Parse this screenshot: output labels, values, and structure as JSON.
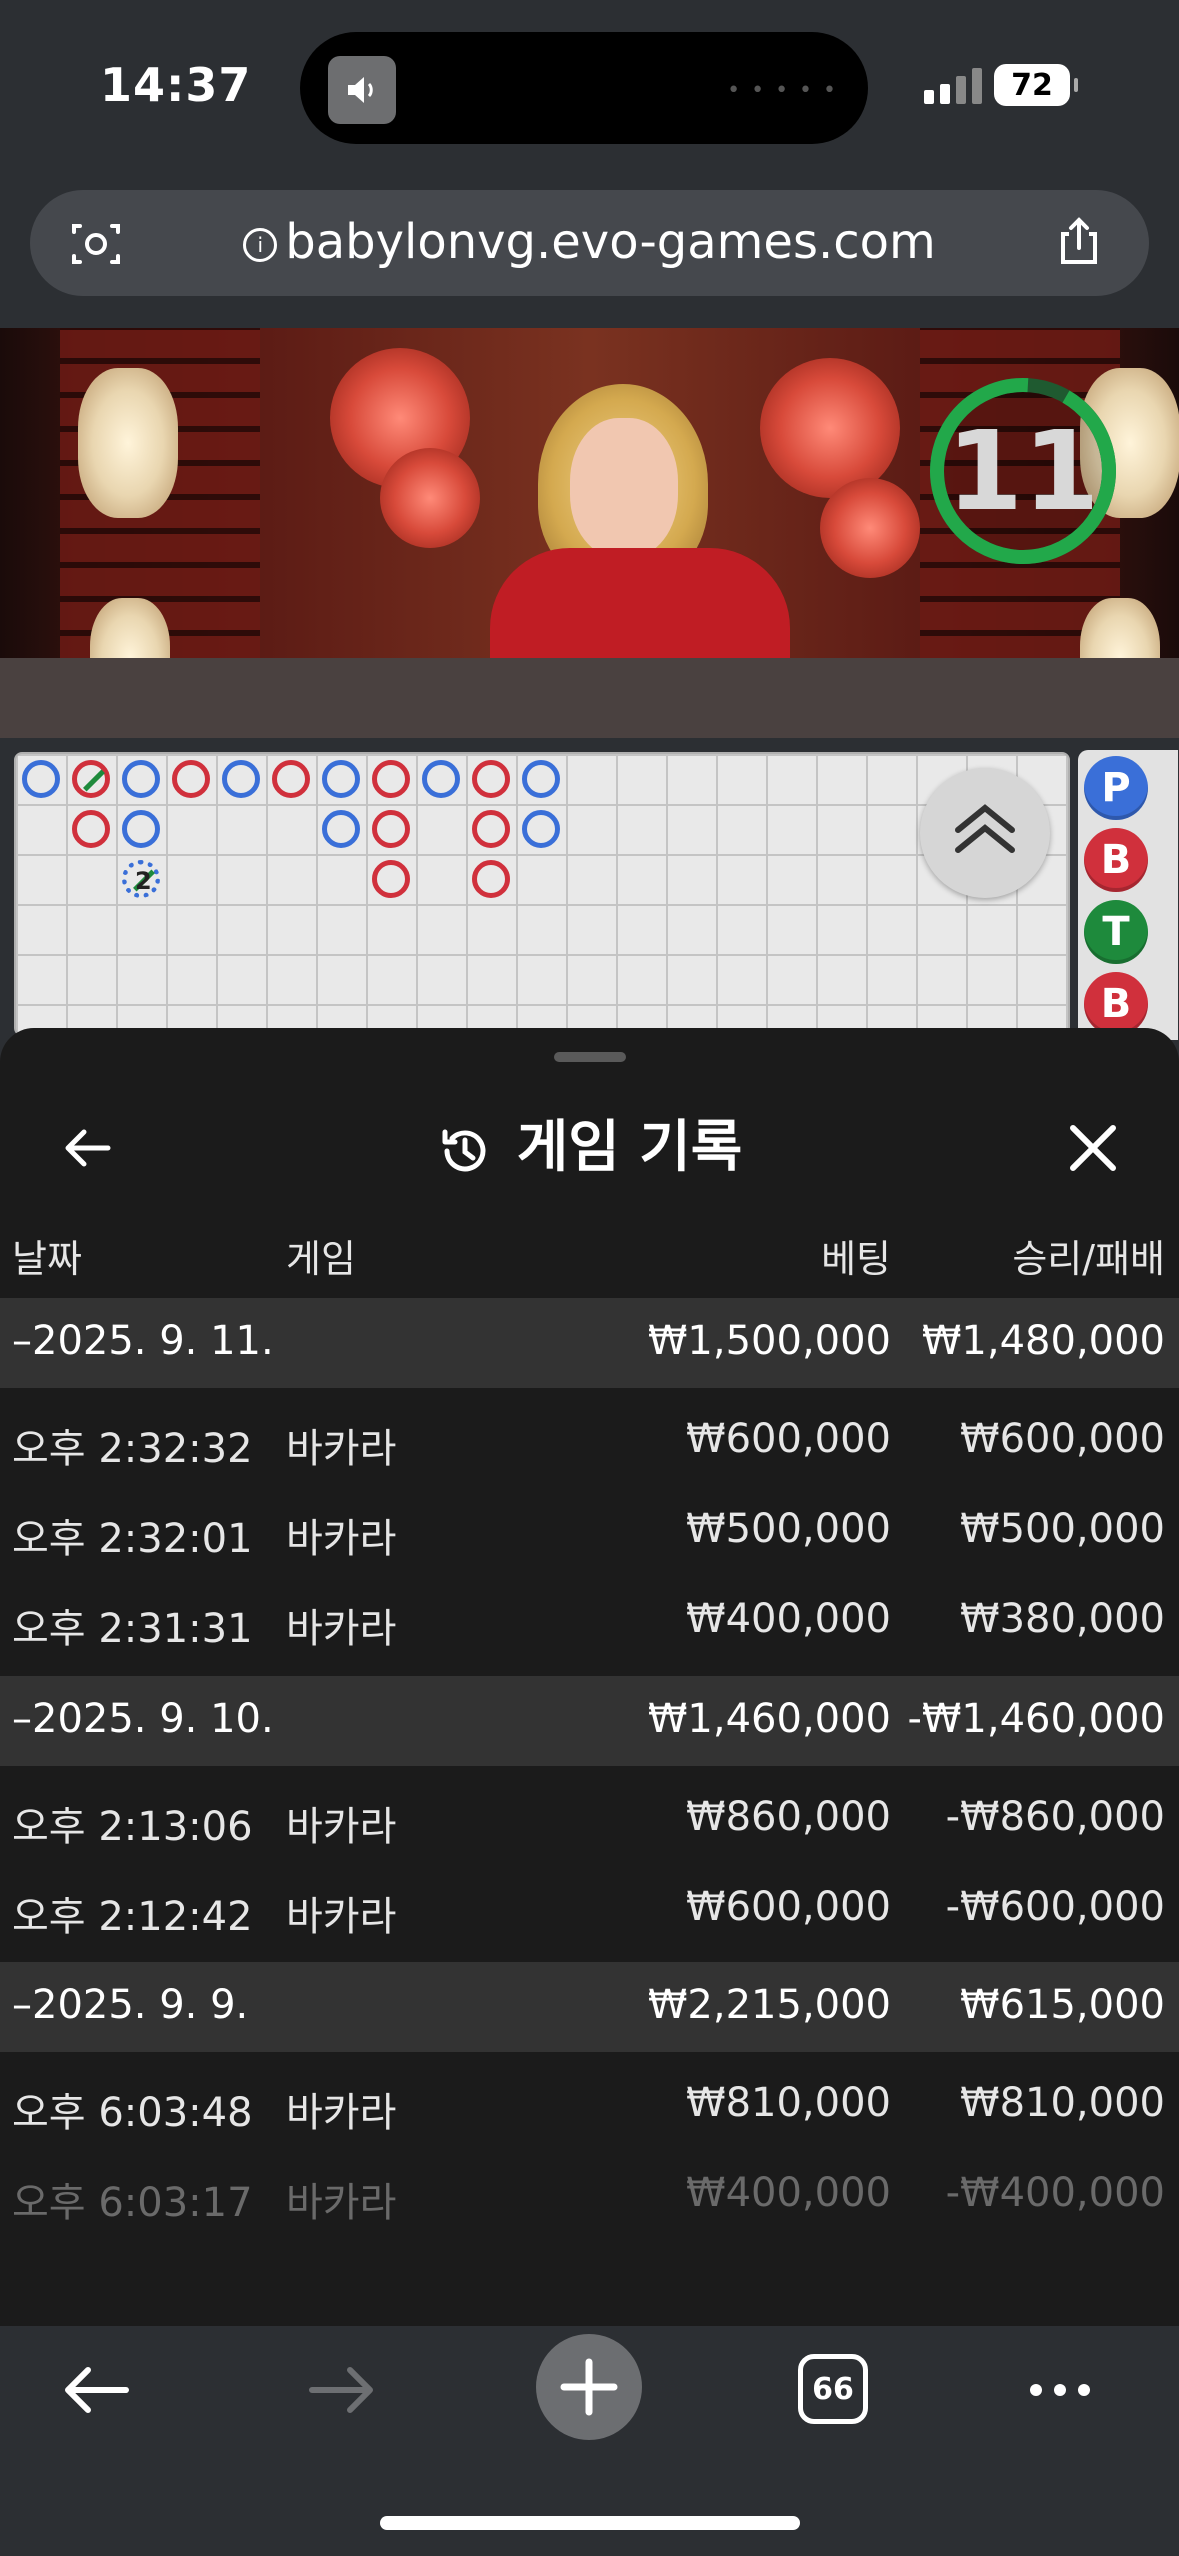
{
  "status_bar": {
    "time": "14:37",
    "battery": "72"
  },
  "browser": {
    "url": "babylonvg.evo-games.com",
    "tabs_count": "66"
  },
  "game": {
    "timer": "11",
    "bead_marker": "2",
    "side_buttons": [
      "P",
      "B",
      "T",
      "B"
    ],
    "colors": {
      "player": "#3a6fd8",
      "banker": "#d0303c",
      "tie": "#1e8a3c",
      "timer_ring": "#22a84a"
    }
  },
  "history_sheet": {
    "title": "게임 기록",
    "columns": {
      "date": "날짜",
      "game": "게임",
      "bet": "베팅",
      "result": "승리/패배"
    },
    "groups": [
      {
        "date": "–2025. 9. 11.",
        "bet": "₩1,500,000",
        "result": "₩1,480,000",
        "rows": [
          {
            "time": "오후 2:32:32",
            "game": "바카라",
            "bet": "₩600,000",
            "result": "₩600,000"
          },
          {
            "time": "오후 2:32:01",
            "game": "바카라",
            "bet": "₩500,000",
            "result": "₩500,000"
          },
          {
            "time": "오후 2:31:31",
            "game": "바카라",
            "bet": "₩400,000",
            "result": "₩380,000"
          }
        ]
      },
      {
        "date": "–2025. 9. 10.",
        "bet": "₩1,460,000",
        "result": "-₩1,460,000",
        "rows": [
          {
            "time": "오후 2:13:06",
            "game": "바카라",
            "bet": "₩860,000",
            "result": "-₩860,000"
          },
          {
            "time": "오후 2:12:42",
            "game": "바카라",
            "bet": "₩600,000",
            "result": "-₩600,000"
          }
        ]
      },
      {
        "date": "–2025. 9. 9.",
        "bet": "₩2,215,000",
        "result": "₩615,000",
        "rows": [
          {
            "time": "오후 6:03:48",
            "game": "바카라",
            "bet": "₩810,000",
            "result": "₩810,000"
          },
          {
            "time": "오후 6:03:17",
            "game": "바카라",
            "bet": "₩400,000",
            "result": "-₩400,000"
          }
        ]
      }
    ]
  }
}
